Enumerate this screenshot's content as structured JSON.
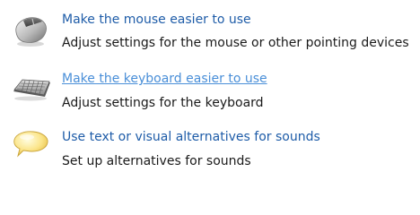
{
  "items": [
    {
      "icon": "mouse-icon",
      "link": "Make the mouse easier to use",
      "description": "Adjust settings for the mouse or other pointing devices",
      "hovered": false
    },
    {
      "icon": "keyboard-icon",
      "link": "Make the keyboard easier to use",
      "description": "Adjust settings for the keyboard",
      "hovered": true
    },
    {
      "icon": "speech-bubble-icon",
      "link": "Use text or visual alternatives for sounds",
      "description": "Set up alternatives for sounds",
      "hovered": false
    }
  ],
  "colors": {
    "link": "#1e5ca8",
    "link_hover": "#4a8fd8",
    "text": "#1a1a1a"
  }
}
